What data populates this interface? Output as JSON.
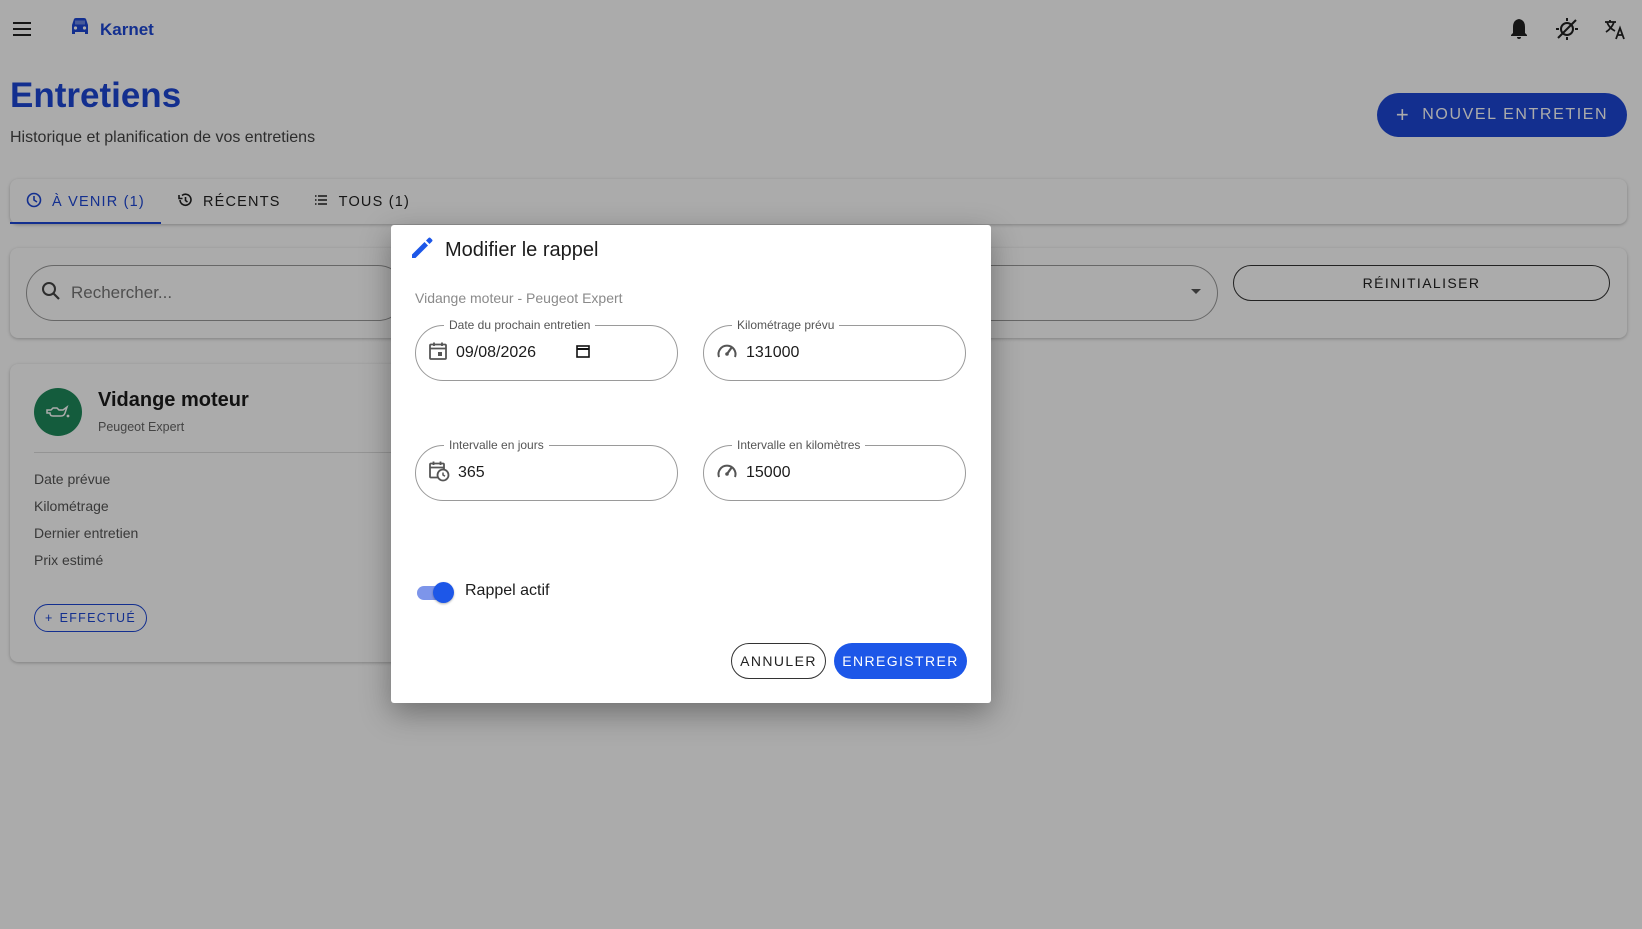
{
  "app": {
    "name": "Karnet"
  },
  "page": {
    "title": "Entretiens",
    "subtitle": "Historique et planification de vos entretiens",
    "new_button": "NOUVEL ENTRETIEN"
  },
  "tabs": [
    {
      "label": "À VENIR (1)",
      "icon": "schedule-icon",
      "active": true
    },
    {
      "label": "RÉCENTS",
      "icon": "history-icon",
      "active": false
    },
    {
      "label": "TOUS (1)",
      "icon": "list-icon",
      "active": false
    }
  ],
  "filters": {
    "search_placeholder": "Rechercher...",
    "reset_label": "RÉINITIALISER"
  },
  "reminder_card": {
    "title": "Vidange moteur",
    "vehicle": "Peugeot Expert",
    "rows": [
      "Date prévue",
      "Kilométrage",
      "Dernier entretien",
      "Prix estimé"
    ],
    "done_button": "EFFECTUÉ"
  },
  "dialog": {
    "title": "Modifier le rappel",
    "context": "Vidange moteur - Peugeot Expert",
    "fields": {
      "next_date": {
        "label": "Date du prochain entretien",
        "value": "09/08/2026"
      },
      "planned_km": {
        "label": "Kilométrage prévu",
        "value": "131000"
      },
      "interval_days": {
        "label": "Intervalle en jours",
        "value": "365"
      },
      "interval_km": {
        "label": "Intervalle en kilomètres",
        "value": "15000"
      }
    },
    "toggle": {
      "label": "Rappel actif",
      "on": true
    },
    "cancel_label": "ANNULER",
    "save_label": "ENREGISTRER"
  },
  "colors": {
    "primary": "#1d47d6",
    "primary_bright": "#1d57e8",
    "avatar": "#1f8a5b"
  }
}
